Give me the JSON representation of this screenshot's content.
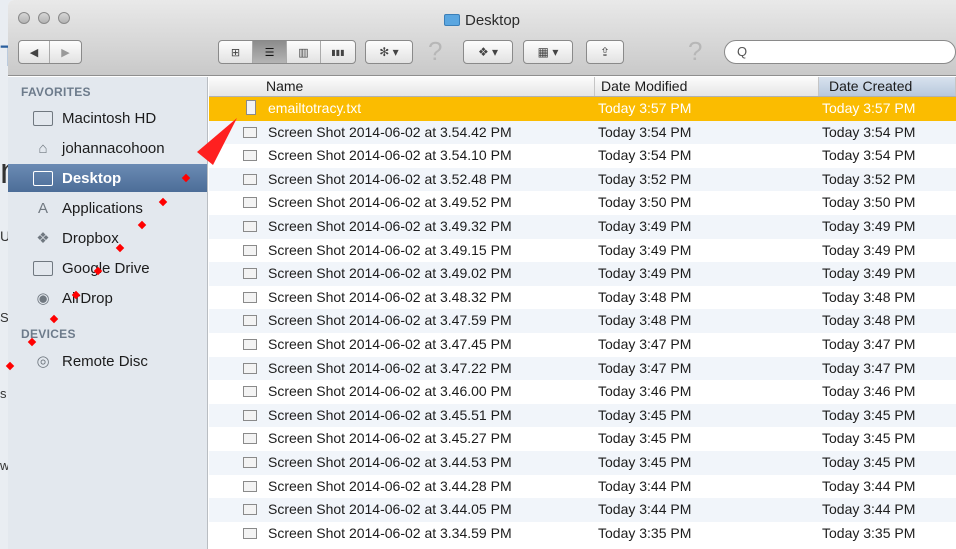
{
  "window": {
    "title": "Desktop"
  },
  "toolbar": {
    "nav_back": "◀",
    "nav_forward": "▶",
    "view_icon": "⊞",
    "view_list": "☰",
    "view_columns": "▥",
    "view_coverflow": "▮▮▮",
    "action_label": "✻ ▾",
    "dropbox_label": "❖ ▾",
    "arrange_label": "▦ ▾",
    "share_label": "⇪",
    "help_label": "?",
    "search_glyph": "Q",
    "search_placeholder": ""
  },
  "sidebar": {
    "favorites_header": "FAVORITES",
    "devices_header": "DEVICES",
    "favorites": [
      {
        "label": "Macintosh HD",
        "icon": "hard-drive-icon"
      },
      {
        "label": "johannacohoon",
        "icon": "home-icon"
      },
      {
        "label": "Desktop",
        "icon": "desktop-icon",
        "selected": true
      },
      {
        "label": "Applications",
        "icon": "applications-icon"
      },
      {
        "label": "Dropbox",
        "icon": "dropbox-icon"
      },
      {
        "label": "Google Drive",
        "icon": "folder-icon"
      },
      {
        "label": "AirDrop",
        "icon": "airdrop-icon"
      }
    ],
    "devices": [
      {
        "label": "Remote Disc",
        "icon": "disc-icon"
      }
    ]
  },
  "columns": {
    "name": "Name",
    "modified": "Date Modified",
    "created": "Date Created"
  },
  "files": [
    {
      "name": "emailtotracy.txt",
      "modified": "Today 3:57 PM",
      "created": "Today 3:57 PM",
      "selected": true,
      "icon": "text-file-icon"
    },
    {
      "name": "Screen Shot 2014-06-02 at 3.54.42 PM",
      "modified": "Today 3:54 PM",
      "created": "Today 3:54 PM"
    },
    {
      "name": "Screen Shot 2014-06-02 at 3.54.10 PM",
      "modified": "Today 3:54 PM",
      "created": "Today 3:54 PM"
    },
    {
      "name": "Screen Shot 2014-06-02 at 3.52.48 PM",
      "modified": "Today 3:52 PM",
      "created": "Today 3:52 PM"
    },
    {
      "name": "Screen Shot 2014-06-02 at 3.49.52 PM",
      "modified": "Today 3:50 PM",
      "created": "Today 3:50 PM"
    },
    {
      "name": "Screen Shot 2014-06-02 at 3.49.32 PM",
      "modified": "Today 3:49 PM",
      "created": "Today 3:49 PM"
    },
    {
      "name": "Screen Shot 2014-06-02 at 3.49.15 PM",
      "modified": "Today 3:49 PM",
      "created": "Today 3:49 PM"
    },
    {
      "name": "Screen Shot 2014-06-02 at 3.49.02 PM",
      "modified": "Today 3:49 PM",
      "created": "Today 3:49 PM"
    },
    {
      "name": "Screen Shot 2014-06-02 at 3.48.32 PM",
      "modified": "Today 3:48 PM",
      "created": "Today 3:48 PM"
    },
    {
      "name": "Screen Shot 2014-06-02 at 3.47.59 PM",
      "modified": "Today 3:48 PM",
      "created": "Today 3:48 PM"
    },
    {
      "name": "Screen Shot 2014-06-02 at 3.47.45 PM",
      "modified": "Today 3:47 PM",
      "created": "Today 3:47 PM"
    },
    {
      "name": "Screen Shot 2014-06-02 at 3.47.22 PM",
      "modified": "Today 3:47 PM",
      "created": "Today 3:47 PM"
    },
    {
      "name": "Screen Shot 2014-06-02 at 3.46.00 PM",
      "modified": "Today 3:46 PM",
      "created": "Today 3:46 PM"
    },
    {
      "name": "Screen Shot 2014-06-02 at 3.45.51 PM",
      "modified": "Today 3:45 PM",
      "created": "Today 3:45 PM"
    },
    {
      "name": "Screen Shot 2014-06-02 at 3.45.27 PM",
      "modified": "Today 3:45 PM",
      "created": "Today 3:45 PM"
    },
    {
      "name": "Screen Shot 2014-06-02 at 3.44.53 PM",
      "modified": "Today 3:45 PM",
      "created": "Today 3:45 PM"
    },
    {
      "name": "Screen Shot 2014-06-02 at 3.44.28 PM",
      "modified": "Today 3:44 PM",
      "created": "Today 3:44 PM"
    },
    {
      "name": "Screen Shot 2014-06-02 at 3.44.05 PM",
      "modified": "Today 3:44 PM",
      "created": "Today 3:44 PM"
    },
    {
      "name": "Screen Shot 2014-06-02 at 3.34.59 PM",
      "modified": "Today 3:35 PM",
      "created": "Today 3:35 PM"
    }
  ],
  "background_glyphs": [
    "T",
    "n",
    "U",
    "St",
    "s i",
    "w"
  ],
  "colors": {
    "selection": "#fbbc00",
    "sidebar_selection": "#5678a6",
    "annotation": "#ff0000"
  }
}
